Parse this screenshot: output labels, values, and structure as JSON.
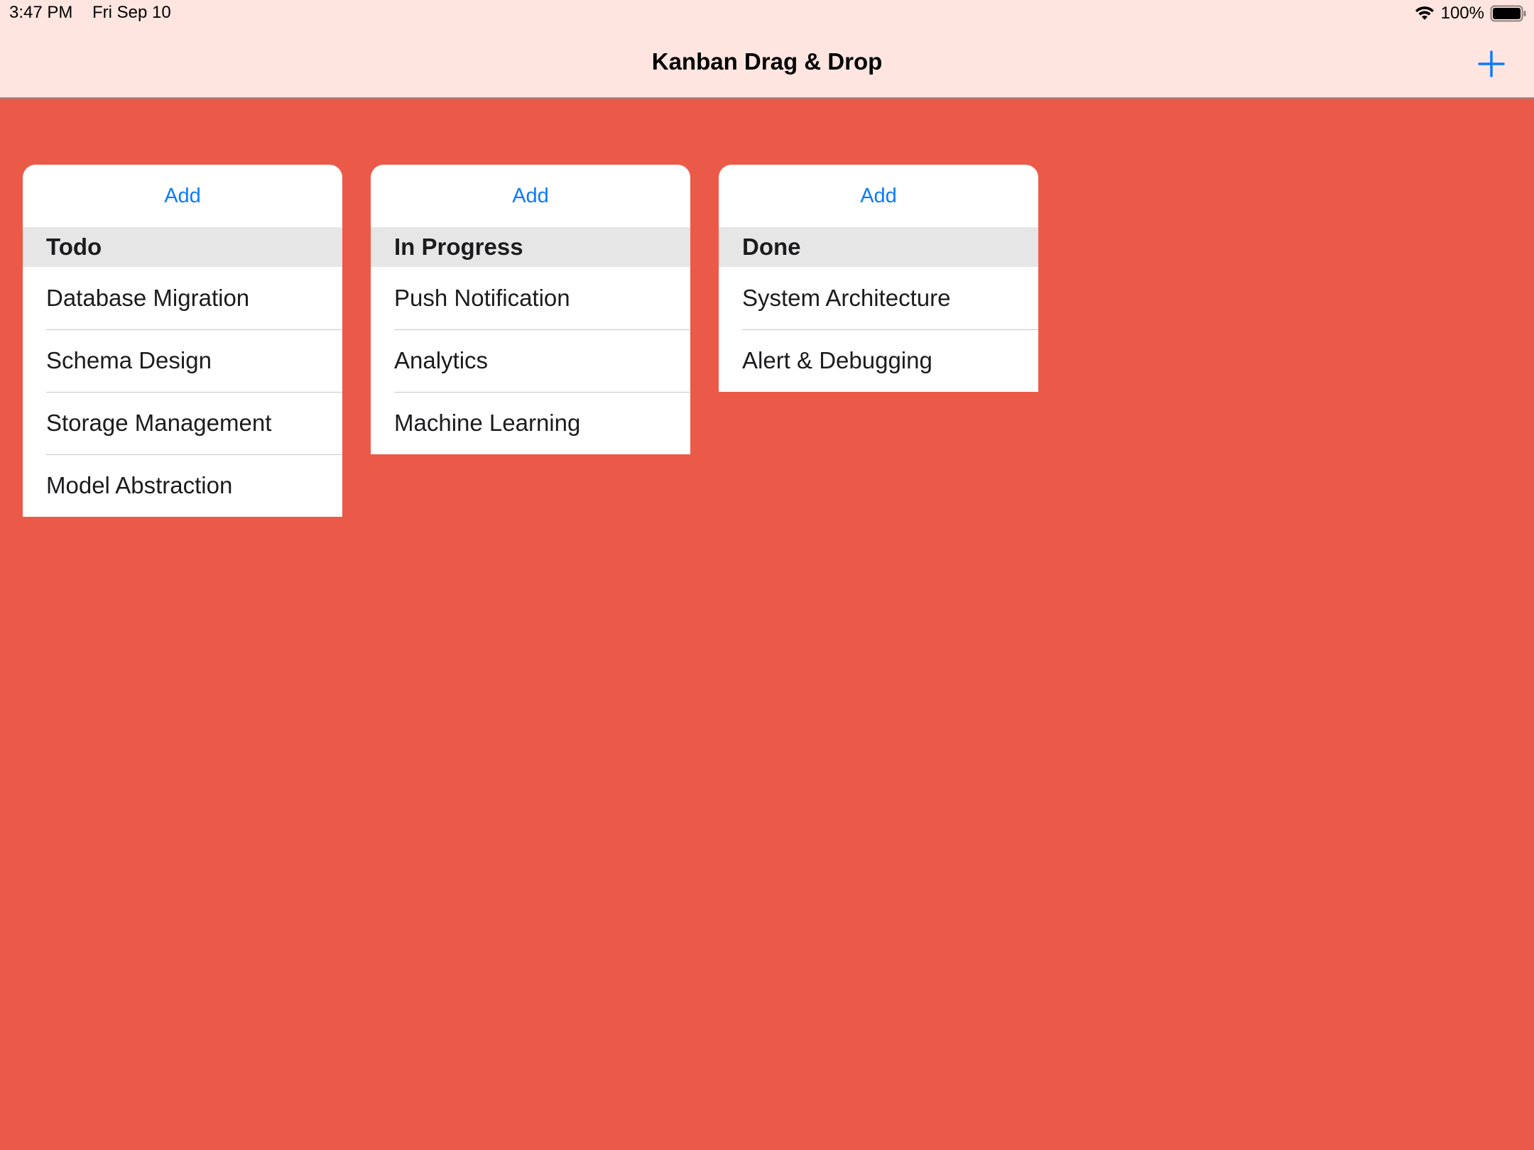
{
  "status_bar": {
    "time": "3:47 PM",
    "date": "Fri Sep 10",
    "battery_percent": "100%",
    "wifi_icon": "wifi-icon",
    "battery_icon": "battery-icon"
  },
  "nav": {
    "title": "Kanban Drag & Drop",
    "add_icon": "plus-icon"
  },
  "colors": {
    "background": "#EB5A48",
    "nav_background": "#FFE5E0",
    "accent": "#0A7AFF",
    "header_background": "#E6E6E6"
  },
  "columns": [
    {
      "add_label": "Add",
      "title": "Todo",
      "cards": [
        "Database Migration",
        "Schema Design",
        "Storage Management",
        "Model Abstraction"
      ]
    },
    {
      "add_label": "Add",
      "title": "In Progress",
      "cards": [
        "Push Notification",
        "Analytics",
        "Machine Learning"
      ]
    },
    {
      "add_label": "Add",
      "title": "Done",
      "cards": [
        "System Architecture",
        "Alert & Debugging"
      ]
    }
  ]
}
